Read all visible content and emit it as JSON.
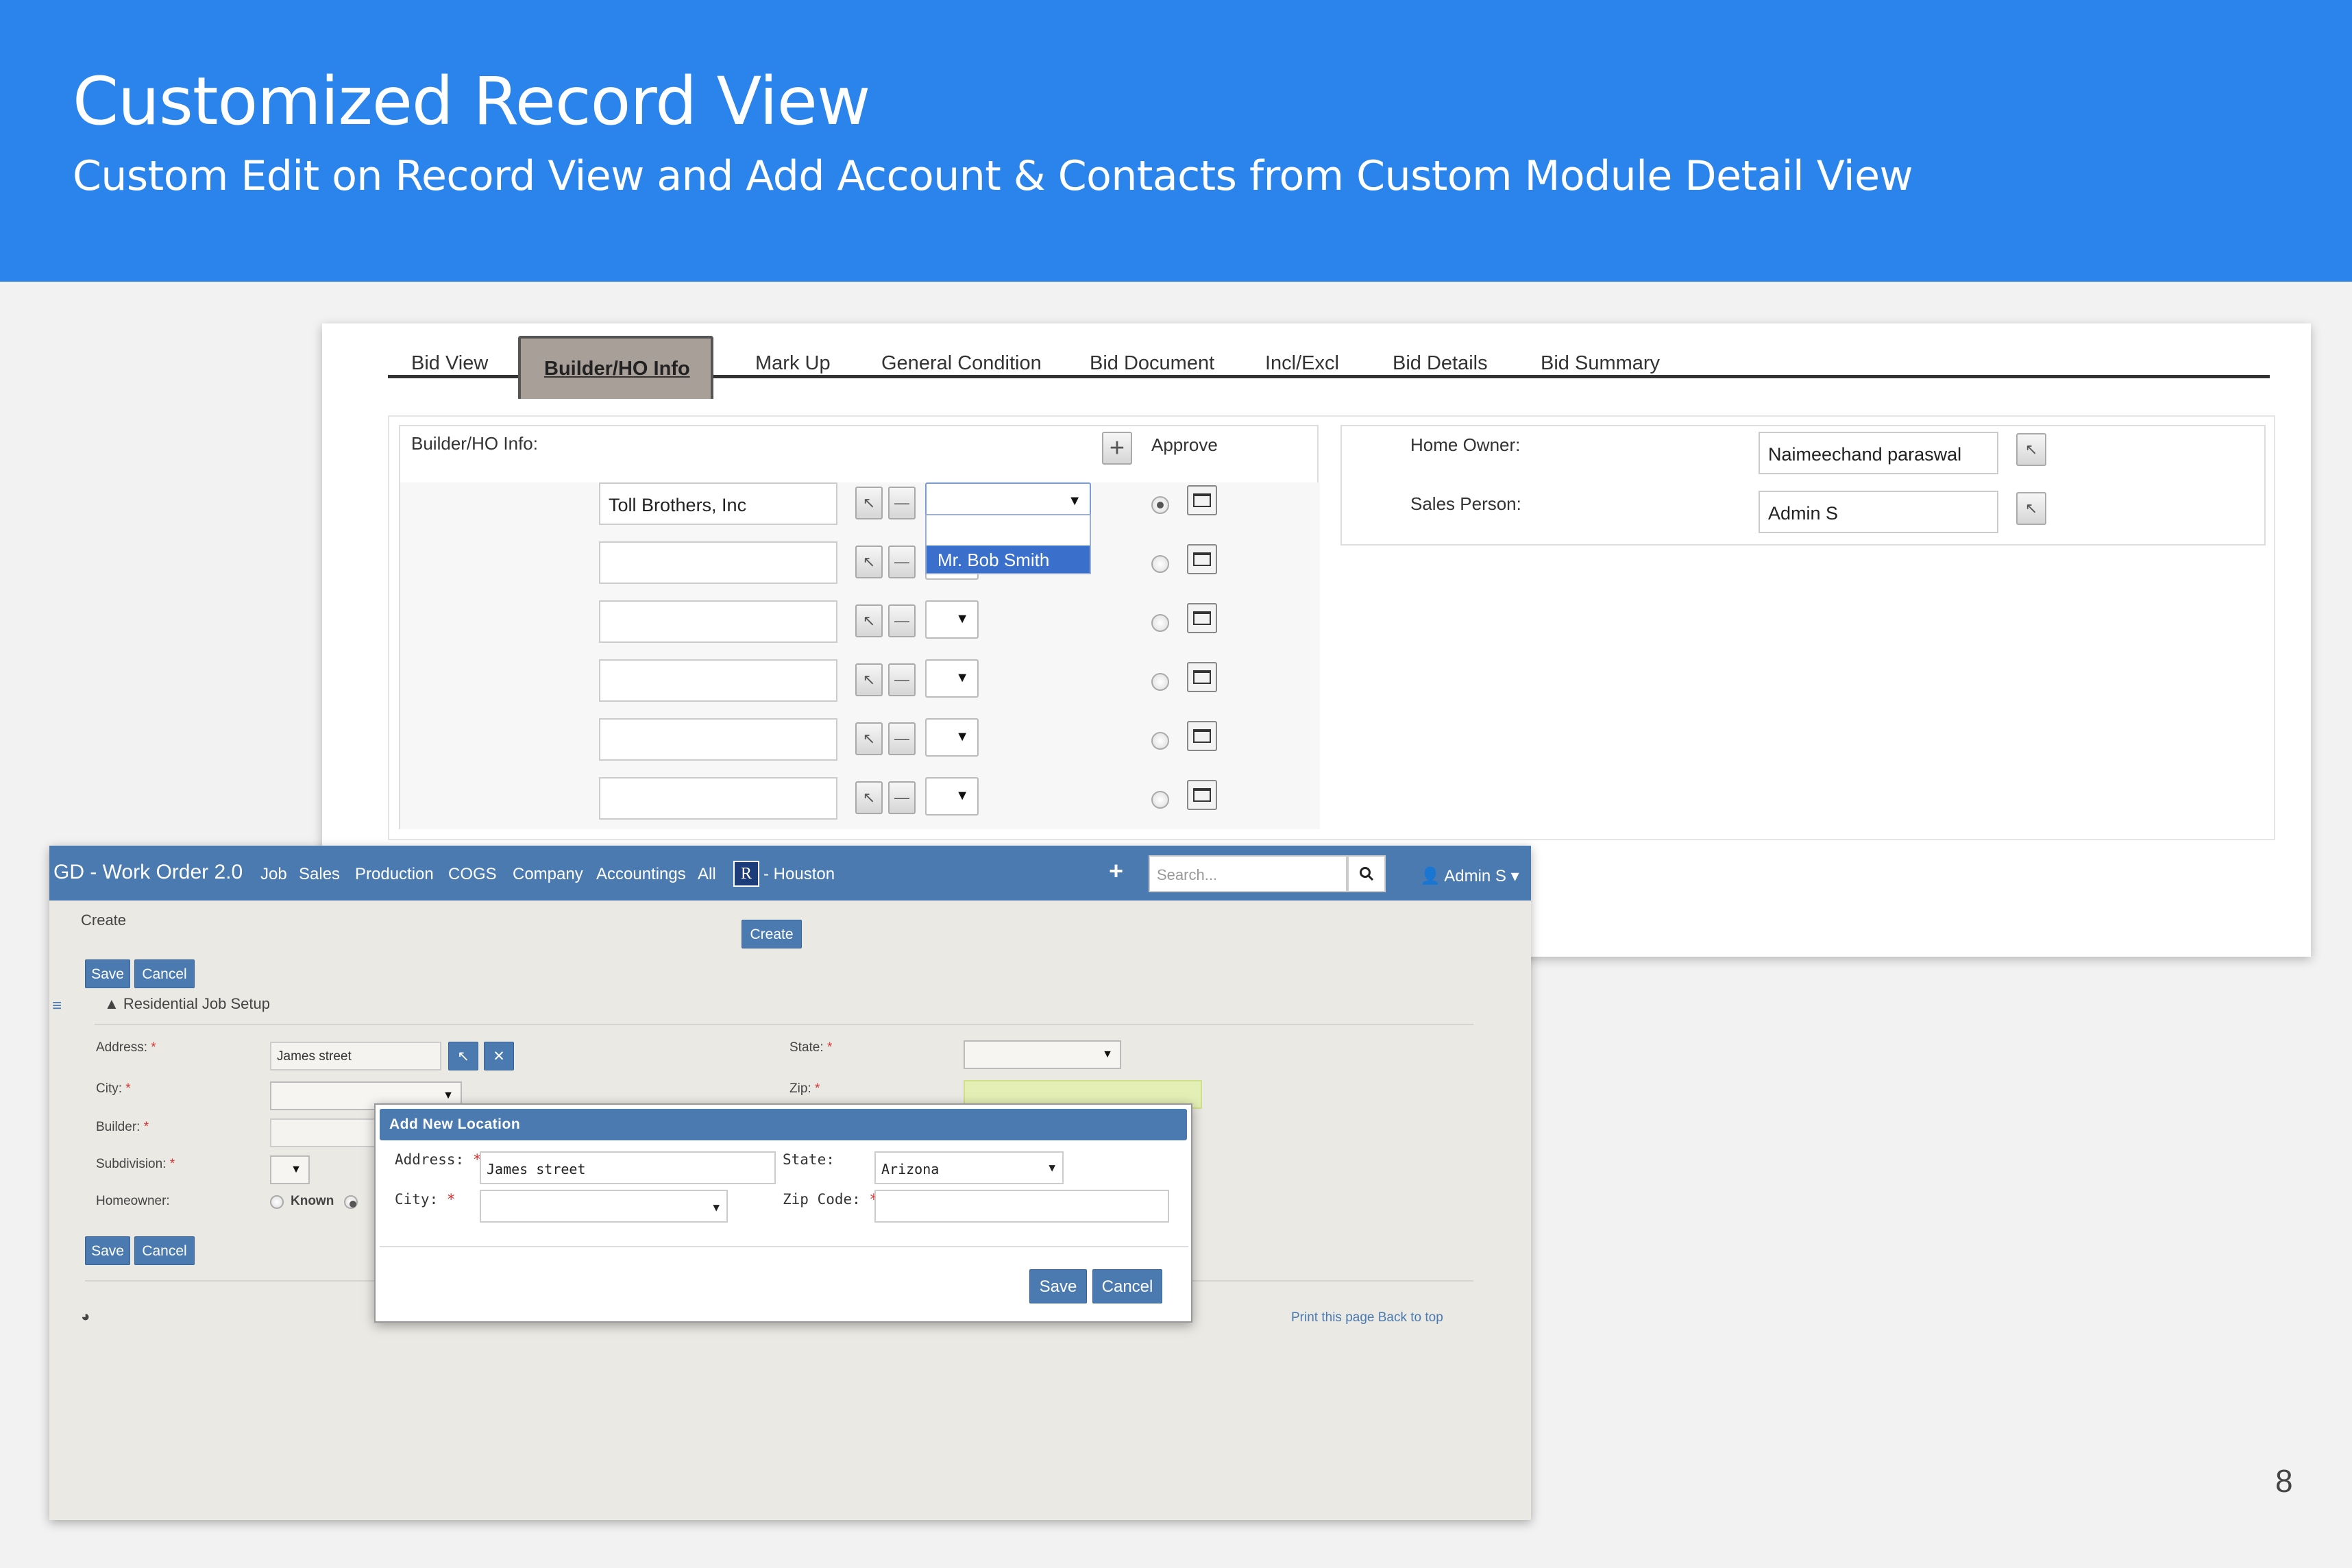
{
  "slide": {
    "title": "Customized Record View",
    "subtitle": "Custom Edit on Record View and Add Account & Contacts from Custom Module Detail View",
    "page_number": "8"
  },
  "colors": {
    "header_blue": "#2a84ec",
    "app_blue": "#4a7ab0",
    "dropdown_highlight": "#3b6fcc"
  },
  "bid_view": {
    "tabs": [
      "Bid View",
      "Builder/HO Info",
      "Mark Up",
      "General Condition",
      "Bid Document",
      "Incl/Excl",
      "Bid Details",
      "Bid Summary"
    ],
    "active_tab": "Builder/HO Info",
    "builder_section_label": "Builder/HO Info:",
    "approve_label": "Approve",
    "builder_rows": [
      {
        "name": "Toll Brothers, Inc",
        "approved": true
      },
      {
        "name": "",
        "approved": false
      },
      {
        "name": "",
        "approved": false
      },
      {
        "name": "",
        "approved": false
      },
      {
        "name": "",
        "approved": false
      },
      {
        "name": "",
        "approved": false
      }
    ],
    "contact_dropdown_option": "Mr. Bob Smith",
    "home_owner_label": "Home Owner:",
    "home_owner_value": "Naimeechand paraswal",
    "sales_person_label": "Sales Person:",
    "sales_person_value": "Admin S",
    "icons": [
      "cursor-icon",
      "minus-icon",
      "plus-icon",
      "folder-icon",
      "dropdown-arrow-icon"
    ]
  },
  "work_order": {
    "brand": "GD - Work Order 2.0",
    "nav": [
      "Job",
      "Sales",
      "Production",
      "COGS",
      "Company",
      "Accountings",
      "All"
    ],
    "location_badge": "R",
    "location": "- Houston",
    "search_placeholder": "Search...",
    "user_menu": "Admin S",
    "page_label": "Create",
    "create_button": "Create",
    "save_label": "Save",
    "cancel_label": "Cancel",
    "section_title": "Residential Job Setup",
    "fields": {
      "address_label": "Address:",
      "address_value": "James street",
      "city_label": "City:",
      "builder_label": "Builder:",
      "subdivision_label": "Subdivision:",
      "homeowner_label": "Homeowner:",
      "known_label": "Known",
      "state_label": "State:",
      "zip_label": "Zip:"
    },
    "footer_links": "Print this page Back to top",
    "modal": {
      "title": "Add New Location",
      "address_label": "Address:",
      "address_value": "James street",
      "state_label": "State:",
      "state_value": "Arizona",
      "city_label": "City:",
      "zip_label": "Zip Code:",
      "save": "Save",
      "cancel": "Cancel"
    }
  }
}
